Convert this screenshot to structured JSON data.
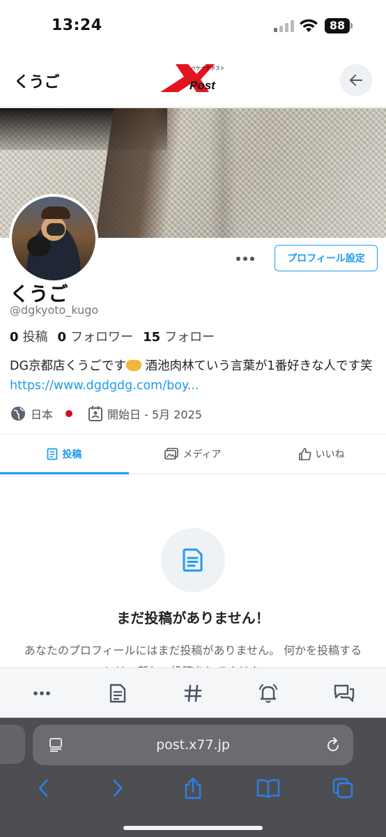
{
  "status_bar": {
    "time": "13:24",
    "battery": "88"
  },
  "header": {
    "title": "くうご",
    "logo_text": "Post",
    "logo_sub": "ペケナナポスト"
  },
  "profile": {
    "display_name": "くうご",
    "handle": "@dgkyoto_kugo",
    "settings_label": "プロフィール設定",
    "stats": [
      {
        "count": "0",
        "label": "投稿"
      },
      {
        "count": "0",
        "label": "フォロワー"
      },
      {
        "count": "15",
        "label": "フォロー"
      }
    ],
    "bio_text": "DG京都店くうごです",
    "bio_text_2": " 酒池肉林ていう言葉が1番好きな人です笑 ",
    "bio_link": "https://www.dgdgdg.com/boy...",
    "location": "日本",
    "joined": "開始日 - 5月 2025"
  },
  "tabs": [
    {
      "label": "投稿",
      "icon": "document-icon"
    },
    {
      "label": "メディア",
      "icon": "image-icon"
    },
    {
      "label": "いいね",
      "icon": "thumbs-up-icon"
    }
  ],
  "empty_state": {
    "title": "まだ投稿がありません！",
    "description": "あなたのプロフィールにはまだ投稿がありません。 何かを投稿するには、新しい投稿をしてください。"
  },
  "toolbar": [
    "more-icon",
    "document-icon",
    "hashtag-icon",
    "bell-icon",
    "chat-icon"
  ],
  "browser": {
    "url": "post.x77.jp"
  },
  "colors": {
    "accent": "#1d9bf0",
    "logo_red": "#e3141d"
  }
}
